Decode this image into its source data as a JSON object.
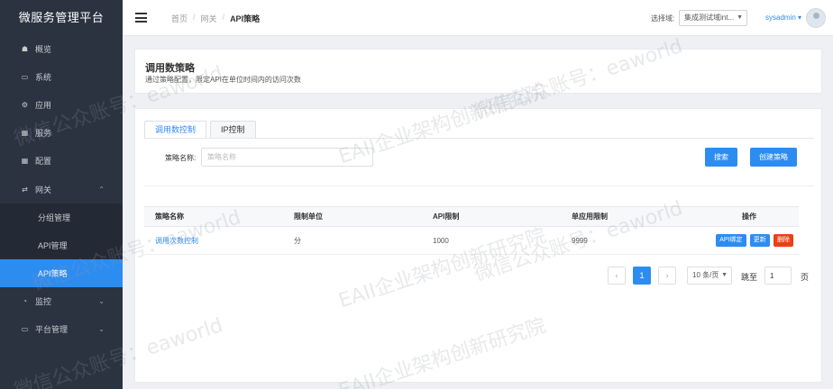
{
  "app_title": "微服务管理平台",
  "sidebar": {
    "items": [
      {
        "label": "概览",
        "icon": "home-icon"
      },
      {
        "label": "系统",
        "icon": "monitor-icon"
      },
      {
        "label": "应用",
        "icon": "gear-icon"
      },
      {
        "label": "服务",
        "icon": "grid-icon"
      },
      {
        "label": "配置",
        "icon": "grid-icon"
      },
      {
        "label": "网关",
        "icon": "shuffle-icon"
      },
      {
        "label": "监控",
        "icon": "gauge-icon"
      },
      {
        "label": "平台管理",
        "icon": "monitor-icon"
      }
    ],
    "gateway_sub": [
      {
        "label": "分组管理"
      },
      {
        "label": "API管理"
      },
      {
        "label": "API策略"
      }
    ]
  },
  "header": {
    "breadcrumb": [
      "首页",
      "网关",
      "API策略"
    ],
    "domain_label": "选择域:",
    "domain_value": "集成测试域int...",
    "user": "sysadmin"
  },
  "page": {
    "title": "调用数策略",
    "description": "通过策略配置，限定API在单位时间内的访问次数"
  },
  "tabs": [
    "调用数控制",
    "IP控制"
  ],
  "search": {
    "label": "策略名称:",
    "placeholder": "策略名称",
    "search_button": "搜索",
    "create_button": "创建策略"
  },
  "table": {
    "headers": [
      "策略名称",
      "限制单位",
      "API限制",
      "单应用限制",
      "操作"
    ],
    "rows": [
      {
        "name": "调用次数控制",
        "unit": "分",
        "api_limit": "1000",
        "app_limit": "9999"
      }
    ],
    "actions": [
      "API绑定",
      "更新",
      "删除"
    ]
  },
  "pagination": {
    "prev": "‹",
    "current": "1",
    "next": "›",
    "page_size": "10 条/页",
    "jump_label": "跳至",
    "jump_value": "1",
    "jump_suffix": "页"
  },
  "watermark": [
    "EAII企业架构创新研究院",
    "微信公众账号：eaworld"
  ],
  "colors": {
    "primary": "#2d8cf0",
    "danger": "#ed3f14",
    "sidebar": "#2b3340"
  }
}
